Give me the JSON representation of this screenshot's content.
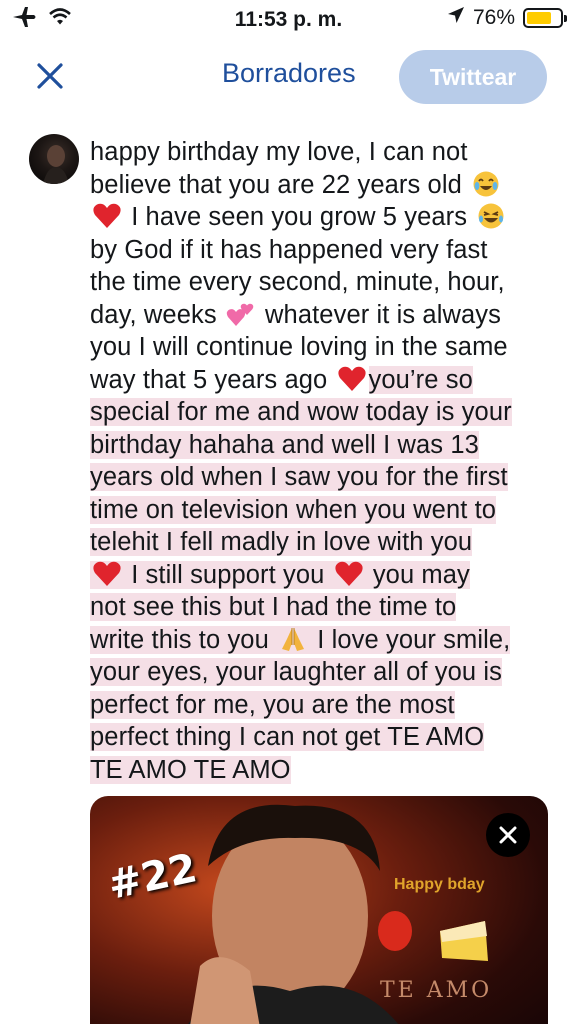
{
  "status_bar": {
    "time": "11:53 p. m.",
    "battery": "76%",
    "battery_level": 0.76
  },
  "nav": {
    "drafts_label": "Borradores",
    "tweet_button_label": "Twittear"
  },
  "compose": {
    "lines": [
      "happy birthday my love, I can not",
      "believe that you are 22 years old",
      "I have seen you grow 5 years",
      "by God if it has happened very fast",
      "the time every second, minute, hour,",
      "day, weeks",
      "whatever it is always",
      "you I will continue loving in the same",
      "way that 5 years ago",
      "you’re so",
      "special for me and wow today is your",
      "birthday hahaha and well I was 13",
      "years old when I saw you for the first",
      "time on television when you went to",
      "telehit I fell madly in love with you",
      "I still support you",
      "you may",
      "not see this but I had the time to",
      "write this to you",
      "I love your smile,",
      "your eyes, your laughter all of you is",
      "perfect for me, you are the most",
      "perfect thing I can not get TE AMO",
      "TE AMO TE AMO"
    ]
  },
  "media": {
    "overlay_22": "#22",
    "overlay_bday": "Happy bday",
    "overlay_amo": "TE AMO"
  },
  "colors": {
    "accent": "#1f4f9c",
    "tweet_button_disabled": "#b8cce9",
    "overflow_highlight": "#f5dfe6",
    "battery": "#ffcc00"
  }
}
